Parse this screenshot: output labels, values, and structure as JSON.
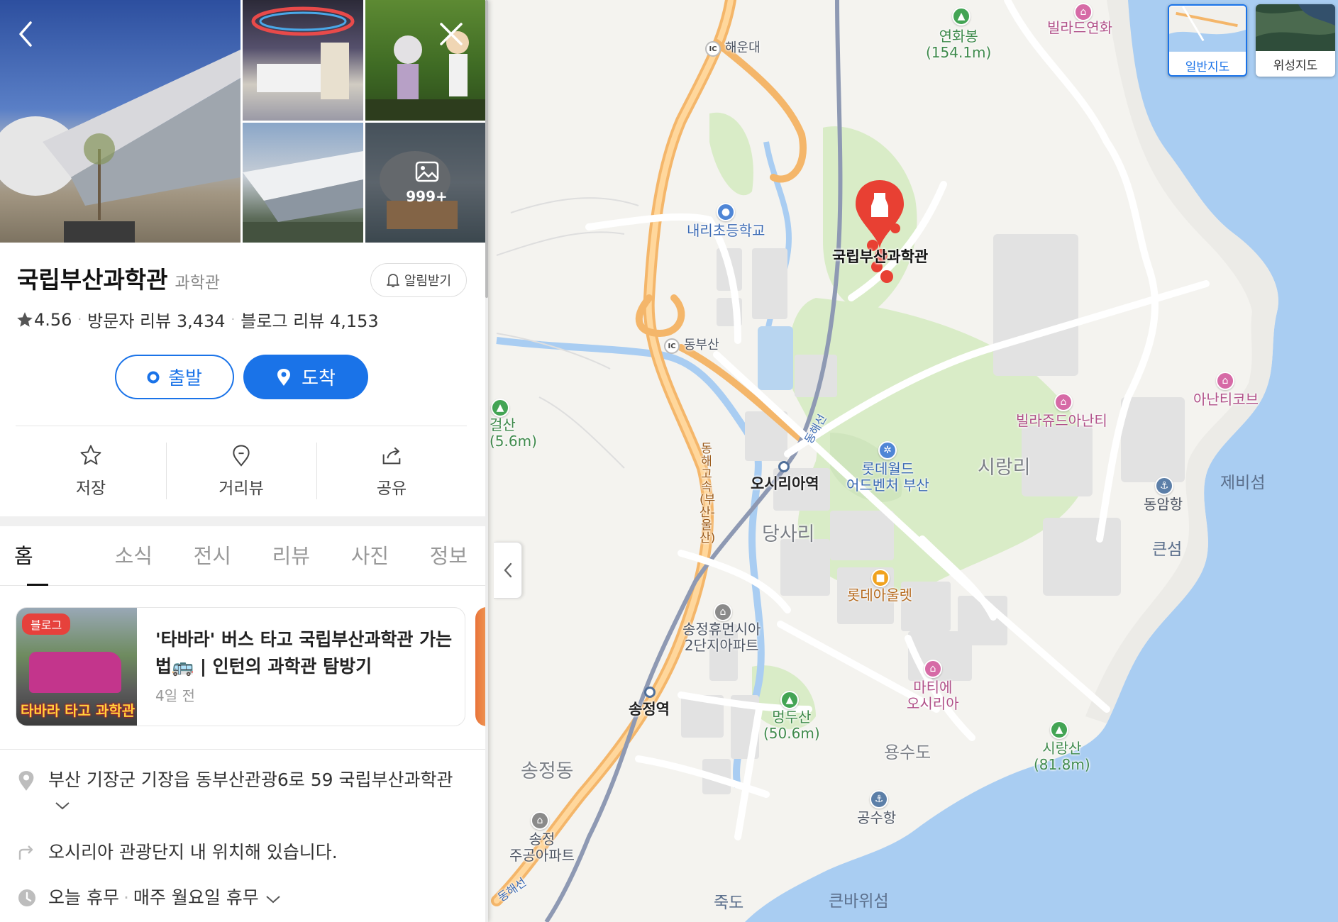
{
  "map": {
    "colors": {
      "land": "#f4f3ef",
      "sea": "#a9cdf2",
      "park": "#d9ecc7",
      "road_main": "#f4b66a",
      "road": "#ffffff",
      "block": "#e2e2e2"
    },
    "labels": {
      "yeonhwabong": "연화봉\n(154.1m)",
      "villa_dreyeonhwa": "빌라드연화",
      "ic_haeundae": "해운대",
      "naeri_school": "내리초등학교",
      "target": "국립부산과학관",
      "ic_dongbusan": "동부산",
      "geolsan": "걸산\n(5.6m)",
      "donghae_highway": "동해고속(부산-울산)",
      "donghae_line": "동해선",
      "osiria_station": "오시리아역",
      "lotteworld": "롯데월드\n어드벤처 부산",
      "sirangri": "시랑리",
      "villa_anantti": "빌라쥬드아난티",
      "anantti_cove": "아난티코브",
      "jebiseom": "제비섬",
      "dongamhang": "동암항",
      "keunseom": "큰섬",
      "dangsari": "당사리",
      "lotte_outlet": "롯데아울렛",
      "songjeong_apt": "송정휴먼시아\n2단지아파트",
      "matie_osiria": "마티에\n오시리아",
      "meongdusan": "멍두산\n(50.6m)",
      "songjeong_station": "송정역",
      "yongsudo": "용수도",
      "sirangsan": "시랑산\n(81.8m)",
      "songjeongdong": "송정동",
      "gongsuhang": "공수항",
      "songjeong_jugong": "송정\n주공아파트",
      "jukdo": "죽도",
      "keunbawiseom": "큰바위섬",
      "donghae_line_bottom": "동해선"
    },
    "ic_badge": "IC",
    "map_types": [
      {
        "label": "일반지도",
        "active": true
      },
      {
        "label": "위성지도",
        "active": false
      }
    ]
  },
  "panel": {
    "photos": {
      "more_count": "999+"
    },
    "place": {
      "name": "국립부산과학관",
      "category": "과학관"
    },
    "alarm_label": "알림받기",
    "rating": {
      "score": "4.56",
      "visitor_review": "방문자 리뷰 3,434",
      "blog_review": "블로그 리뷰 4,153"
    },
    "route": {
      "start": "출발",
      "arrive": "도착"
    },
    "actions": [
      {
        "label": "저장",
        "icon": "star-icon"
      },
      {
        "label": "거리뷰",
        "icon": "pin-outline-icon"
      },
      {
        "label": "공유",
        "icon": "share-icon"
      }
    ],
    "tabs": [
      "홈",
      "소식",
      "전시",
      "리뷰",
      "사진",
      "정보"
    ],
    "blog": {
      "badge": "블로그",
      "title": "'타바라' 버스 타고 국립부산과학관 가는 법🚌 | 인턴의 과학관 탐방기",
      "time": "4일 전",
      "thumb_caption": "타바라 타고 과학관"
    },
    "info": {
      "address": "부산 기장군 기장읍 동부산관광6로 59 국립부산과학관",
      "direction": "오시리아 관광단지 내 위치해 있습니다.",
      "hours_status": "오늘 휴무",
      "hours_detail": "매주 월요일 휴무"
    }
  }
}
